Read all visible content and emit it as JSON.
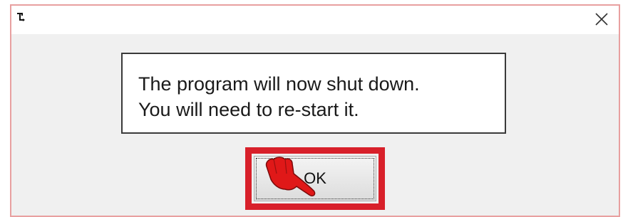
{
  "dialog": {
    "icons": {
      "app": "app-icon",
      "close": "close-icon",
      "cursor": "hand-pointer-icon"
    },
    "message": {
      "line1": "The program will now shut down.",
      "line2": "You will need to re-start it."
    },
    "ok_label": "OK"
  },
  "colors": {
    "highlight": "#d8202a",
    "cursor": "#e01818",
    "dialog_border": "#e8a0a0"
  }
}
